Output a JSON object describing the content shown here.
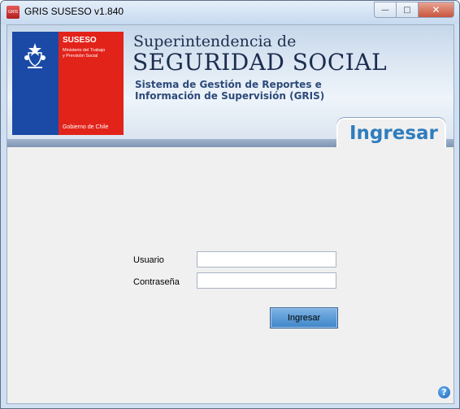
{
  "window": {
    "title": "GRIS SUSESO v1.840",
    "app_icon_text": "GRIS",
    "controls": {
      "minimize": "—",
      "maximize": "□",
      "close": "✕"
    }
  },
  "banner": {
    "logo": {
      "name": "SUSESO",
      "ministry_line1": "Ministerio del Trabajo",
      "ministry_line2": "y Previsión Social",
      "government": "Gobierno de Chile",
      "colors": {
        "blue": "#1a4aa6",
        "red": "#e2231a"
      }
    },
    "heading_small": "Superintendencia de",
    "heading_large": "SEGURIDAD SOCIAL",
    "system_line1": "Sistema de Gestión de Reportes e",
    "system_line2": "Información de Supervisión (GRIS)",
    "tab_label": "Ingresar"
  },
  "form": {
    "username_label": "Usuario",
    "username_value": "",
    "password_label": "Contraseña",
    "password_value": "",
    "submit_label": "Ingresar"
  },
  "help": {
    "symbol": "?"
  }
}
